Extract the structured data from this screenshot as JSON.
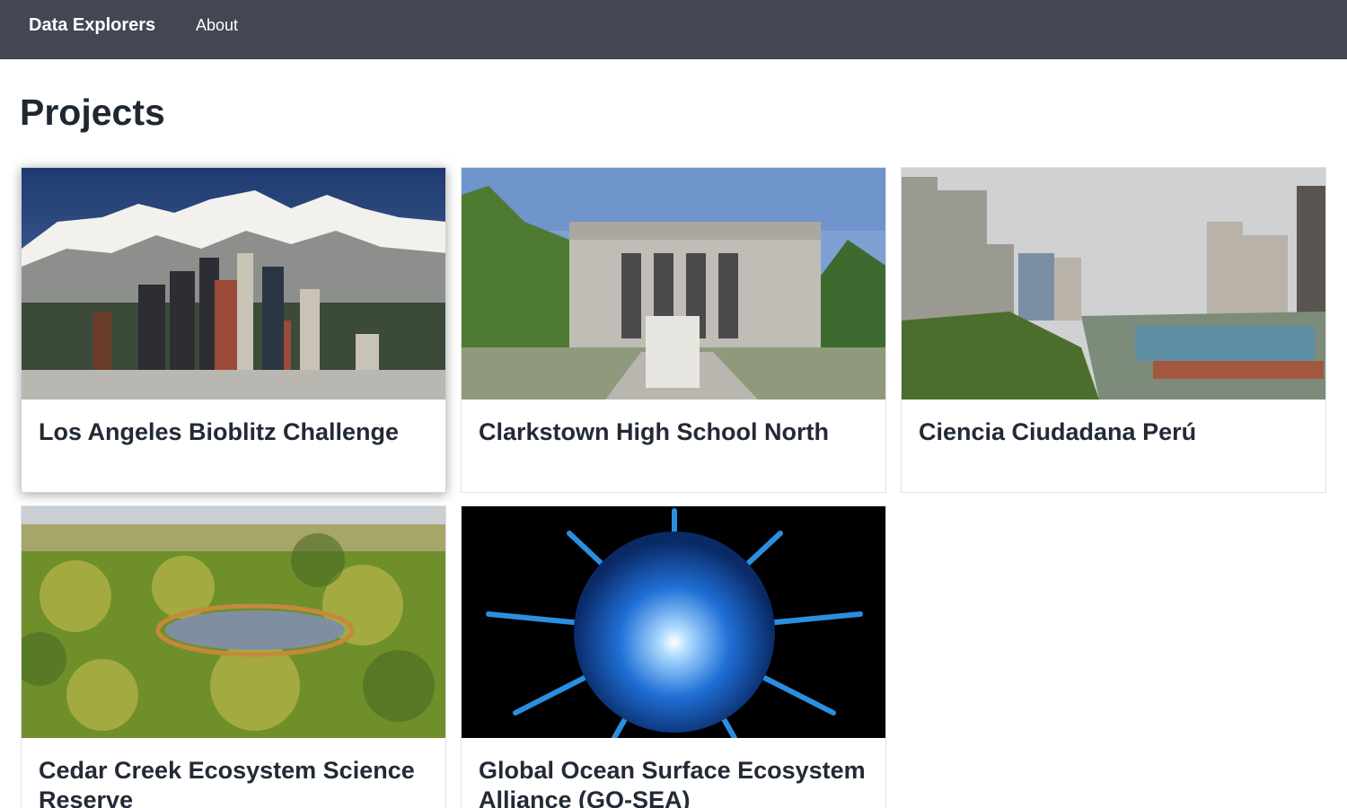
{
  "nav": {
    "brand": "Data Explorers",
    "links": [
      {
        "label": "About"
      }
    ]
  },
  "page": {
    "title": "Projects"
  },
  "projects": [
    {
      "title": "Los Angeles Bioblitz Challenge",
      "image": "city-skyline-with-snowy-mountains"
    },
    {
      "title": "Clarkstown High School North",
      "image": "school-building-facade"
    },
    {
      "title": "Ciencia Ciudadana Perú",
      "image": "coastal-city-park"
    },
    {
      "title": "Cedar Creek Ecosystem Science Reserve",
      "image": "forest-lake-aerial"
    },
    {
      "title": "Global Ocean Surface Ecosystem Alliance (GO-SEA)",
      "image": "blue-sea-creature"
    }
  ],
  "colors": {
    "navbar": "#434753",
    "text": "#222a35"
  }
}
